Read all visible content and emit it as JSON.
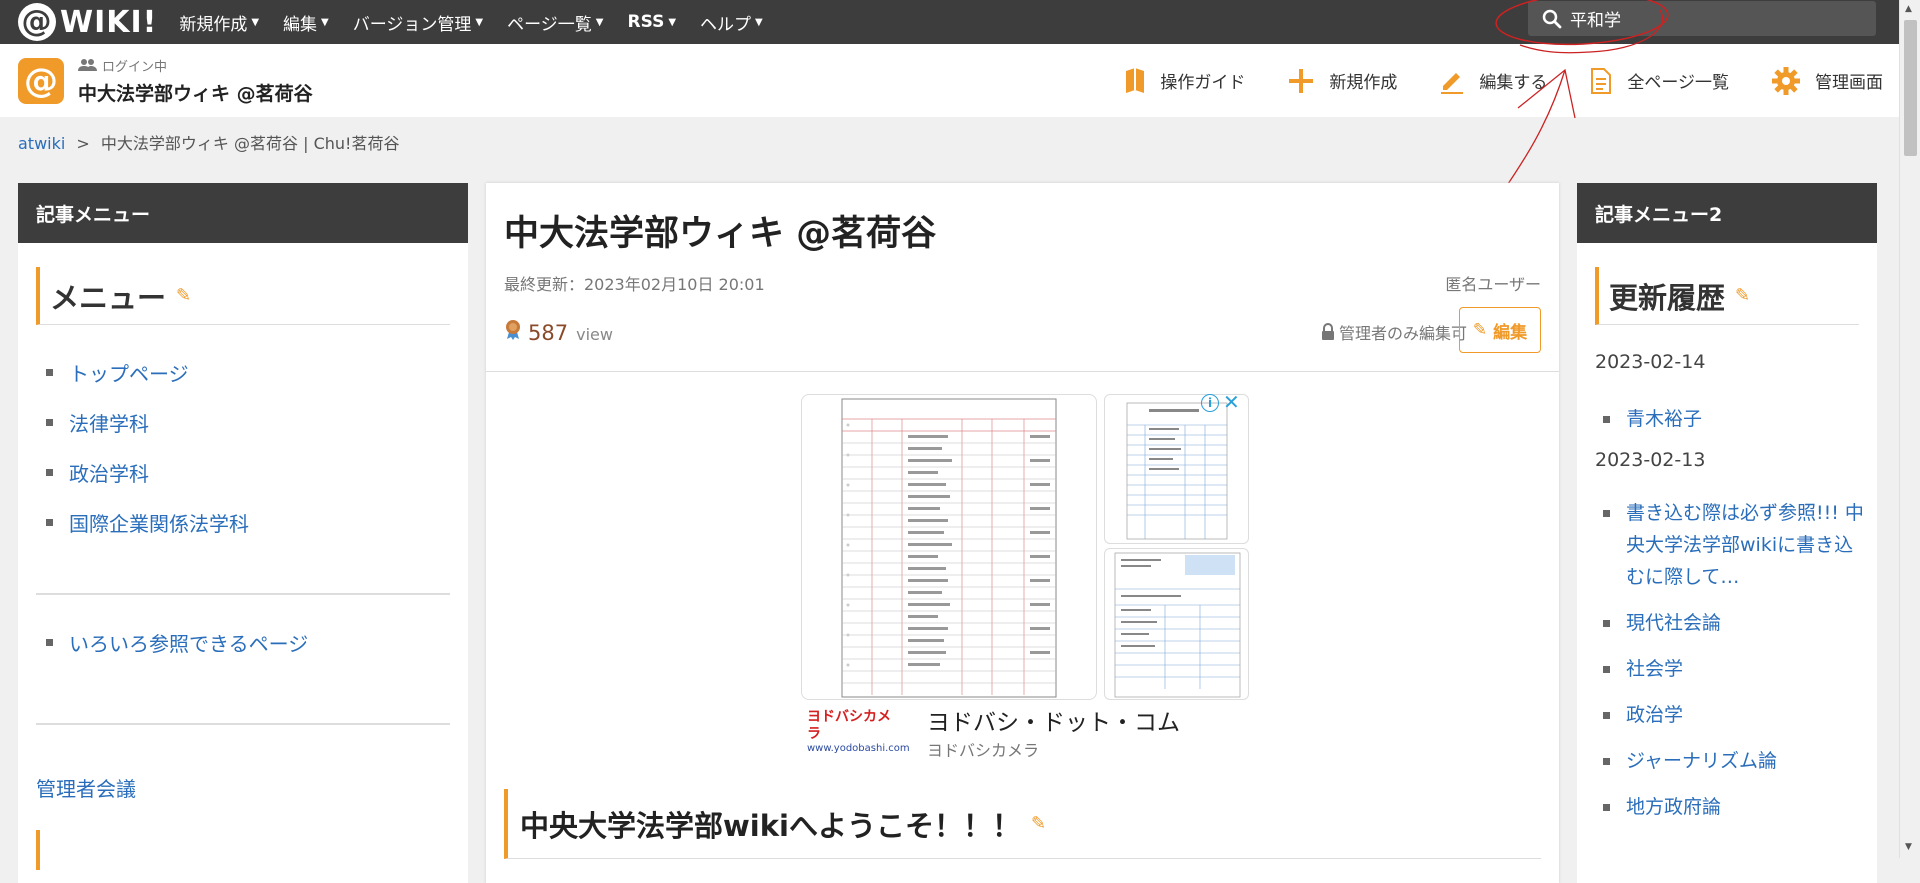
{
  "topbar": {
    "logo": "WIKI!",
    "nav": [
      "新規作成",
      "編集",
      "バージョン管理",
      "ページ一覧",
      "RSS",
      "ヘルプ"
    ],
    "search_value": "平和学"
  },
  "header": {
    "login_status": "ログイン中",
    "site_name": "中大法学部ウィキ @茗荷谷",
    "actions": [
      "操作ガイド",
      "新規作成",
      "編集する",
      "全ページ一覧",
      "管理画面"
    ]
  },
  "breadcrumb": {
    "root": "atwiki",
    "sep": ">",
    "current": "中大法学部ウィキ @茗荷谷 | Chu!茗荷谷"
  },
  "left": {
    "title": "記事メニュー",
    "menu_heading": "メニュー",
    "items": [
      "トップページ",
      "法律学科",
      "政治学科",
      "国際企業関係法学科"
    ],
    "items2": [
      "いろいろ参照できるページ"
    ],
    "link": "管理者会議"
  },
  "main": {
    "title": "中大法学部ウィキ @茗荷谷",
    "updated": "最終更新：2023年02月10日 20:01",
    "author": "匿名ユーザー",
    "views": "587",
    "views_label": "view",
    "admin_only": "管理者のみ編集可",
    "edit_label": "編集",
    "ad": {
      "logo": "ヨドバシカメラ",
      "logo_url": "www.yodobashi.com",
      "title": "ヨドバシ・ドット・コム",
      "subtitle": "ヨドバシカメラ"
    },
    "welcome": "中央大学法学部wikiへようこそ！！！"
  },
  "right": {
    "title": "記事メニュー2",
    "heading": "更新履歴",
    "groups": [
      {
        "date": "2023-02-14",
        "items": [
          "青木裕子"
        ]
      },
      {
        "date": "2023-02-13",
        "items": [
          "書き込む際は必ず参照!!! 中央大学法学部wikiに書き込むに際して…",
          "現代社会論",
          "社会学",
          "政治学",
          "ジャーナリズム論",
          "地方政府論"
        ]
      }
    ]
  },
  "colors": {
    "accent": "#f09a2a",
    "dark": "#3d3d3d",
    "link": "#2a6ebb",
    "annotation": "#cc2222"
  }
}
